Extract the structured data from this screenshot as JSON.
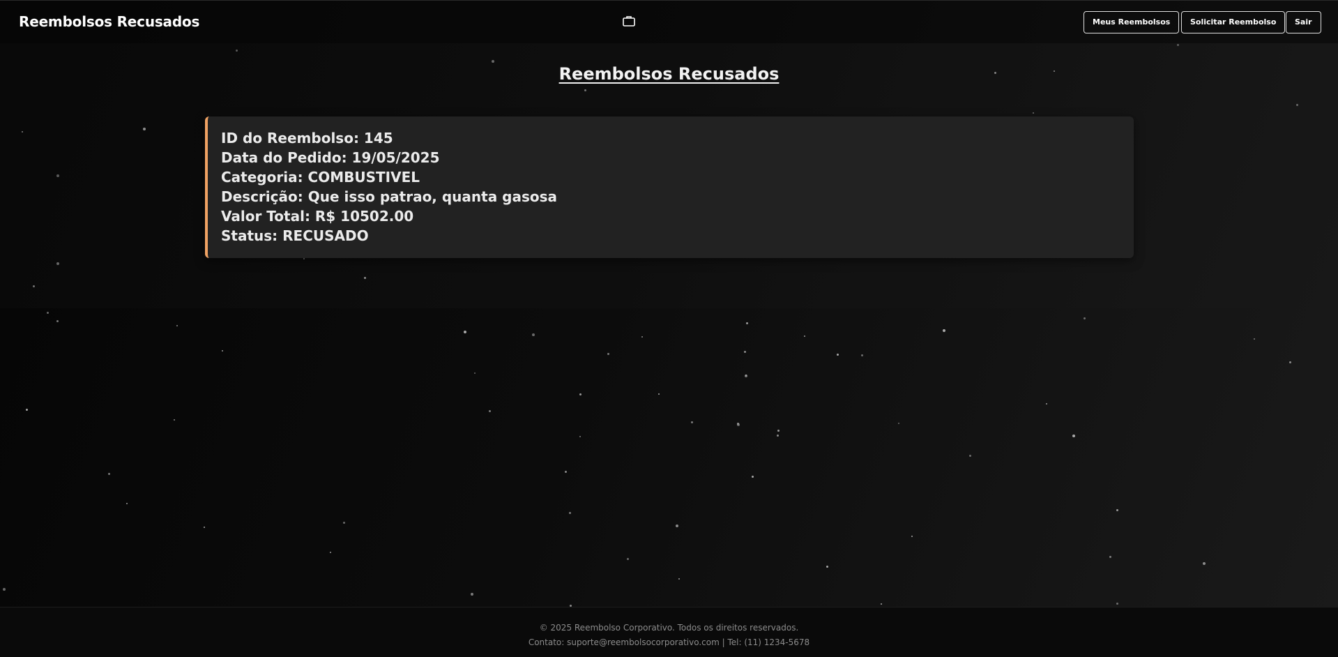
{
  "header": {
    "brand": "Reembolsos Recusados",
    "icon": "briefcase-icon",
    "buttons": {
      "meus_reembolsos": "Meus Reembolsos",
      "solicitar_reembolso": "Solicitar Reembolso",
      "sair": "Sair"
    }
  },
  "main": {
    "title": "Reembolsos Recusados",
    "card": {
      "accent_color": "#f0a263",
      "lines": [
        "ID do Reembolso: 145",
        "Data do Pedido: 19/05/2025",
        "Categoria: COMBUSTIVEL",
        "Descrição: Que isso patrao, quanta gasosa",
        "Valor Total: R$ 10502.00",
        "Status: RECUSADO"
      ]
    }
  },
  "footer": {
    "copyright": "© 2025 Reembolso Corporativo. Todos os direitos reservados.",
    "contact": "Contato: suporte@reembolsocorporativo.com | Tel: (11) 1234-5678"
  }
}
